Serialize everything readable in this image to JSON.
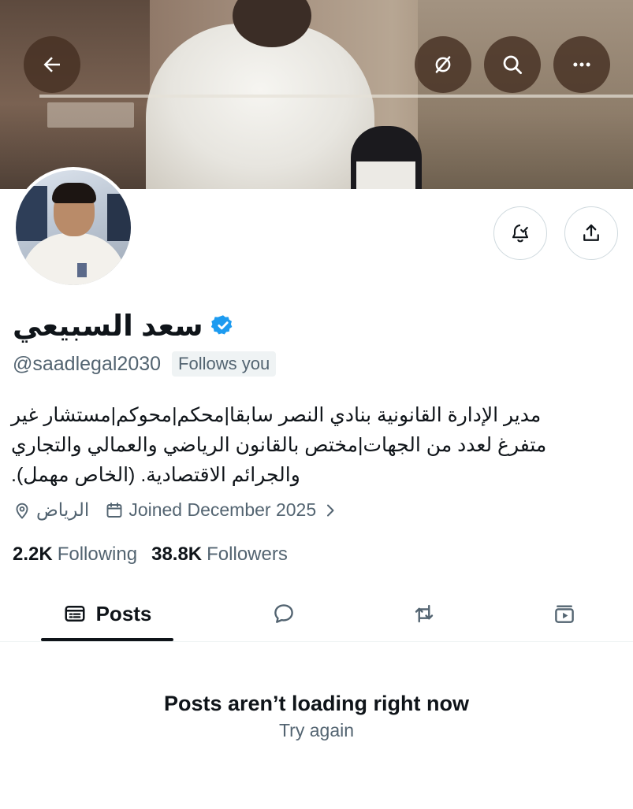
{
  "header": {
    "back_icon": "arrow-left-icon",
    "buttons": [
      {
        "icon": "no-translate-icon"
      },
      {
        "icon": "search-icon"
      },
      {
        "icon": "more-icon"
      }
    ]
  },
  "profile": {
    "display_name": "سعد السبيعي",
    "verified": true,
    "handle": "@saadlegal2030",
    "follows_you": "Follows you",
    "bio_lines": [
      "مدير الإدارة القانونية بنادي النصر سابقا|محكم|محوكم|مستشار غير",
      "متفرغ لعدد من الجهات|مختص بالقانون الرياضي والعمالي والتجاري",
      "والجرائم الاقتصادية. (الخاص مهمل)."
    ],
    "location": "الرياض",
    "joined": "Joined December 2025",
    "following_count": "2.2K",
    "following_label": "Following",
    "followers_count": "38.8K",
    "followers_label": "Followers"
  },
  "actions": {
    "notify_icon": "bell-check-icon",
    "share_icon": "share-icon"
  },
  "tabs": {
    "posts_label": "Posts",
    "active": "posts"
  },
  "empty_state": {
    "title": "Posts aren’t loading right now",
    "retry": "Try again"
  },
  "colors": {
    "accent_verified": "#1d9bf0",
    "text_primary": "#0f1419",
    "text_secondary": "#536471",
    "overlay_button": "#46302280"
  }
}
